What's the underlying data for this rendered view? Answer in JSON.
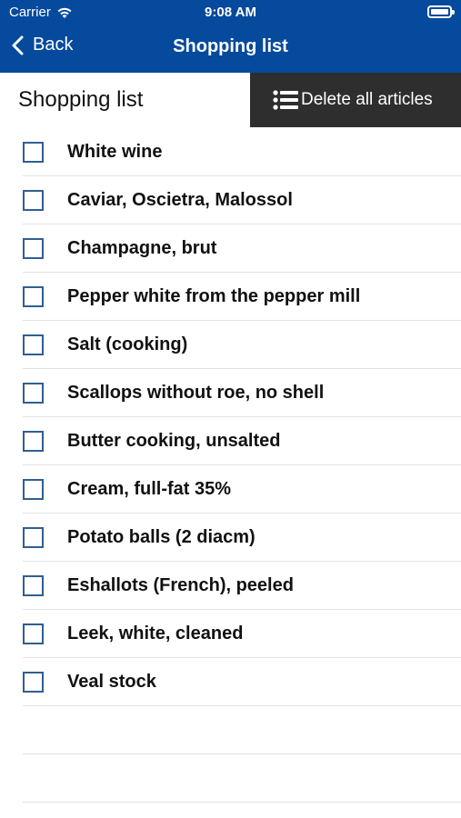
{
  "status_bar": {
    "carrier": "Carrier",
    "time": "9:08 AM"
  },
  "nav": {
    "back_label": "Back",
    "title": "Shopping list"
  },
  "header": {
    "heading": "Shopping list",
    "delete_all_label": "Delete all articles"
  },
  "items": [
    {
      "label": "White wine",
      "checked": false
    },
    {
      "label": "Caviar, Oscietra, Malossol",
      "checked": false
    },
    {
      "label": "Champagne, brut",
      "checked": false
    },
    {
      "label": "Pepper white from the pepper mill",
      "checked": false
    },
    {
      "label": "Salt (cooking)",
      "checked": false
    },
    {
      "label": "Scallops without roe, no shell",
      "checked": false
    },
    {
      "label": "Butter cooking, unsalted",
      "checked": false
    },
    {
      "label": "Cream, full-fat 35%",
      "checked": false
    },
    {
      "label": "Potato balls (2 diacm)",
      "checked": false
    },
    {
      "label": "Eshallots (French), peeled",
      "checked": false
    },
    {
      "label": "Leek, white, cleaned",
      "checked": false
    },
    {
      "label": "Veal stock",
      "checked": false
    }
  ],
  "colors": {
    "nav_background": "#054a9c",
    "delete_button_background": "#2e2e2e",
    "checkbox_border": "#2f5f92"
  }
}
